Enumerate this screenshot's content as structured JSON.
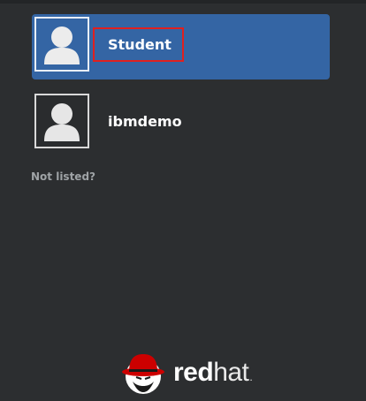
{
  "users": [
    {
      "name": "Student",
      "selected": true
    },
    {
      "name": "ibmdemo",
      "selected": false
    }
  ],
  "not_listed_label": "Not listed?",
  "brand": {
    "name_red": "red",
    "name_hat": "hat",
    "trademark_dot": ".",
    "icon": "redhat-shadowman-icon"
  },
  "colors": {
    "background": "#2c2e30",
    "selected": "#3465a4",
    "highlight": "#e0201f",
    "brand_red": "#cc0000"
  }
}
